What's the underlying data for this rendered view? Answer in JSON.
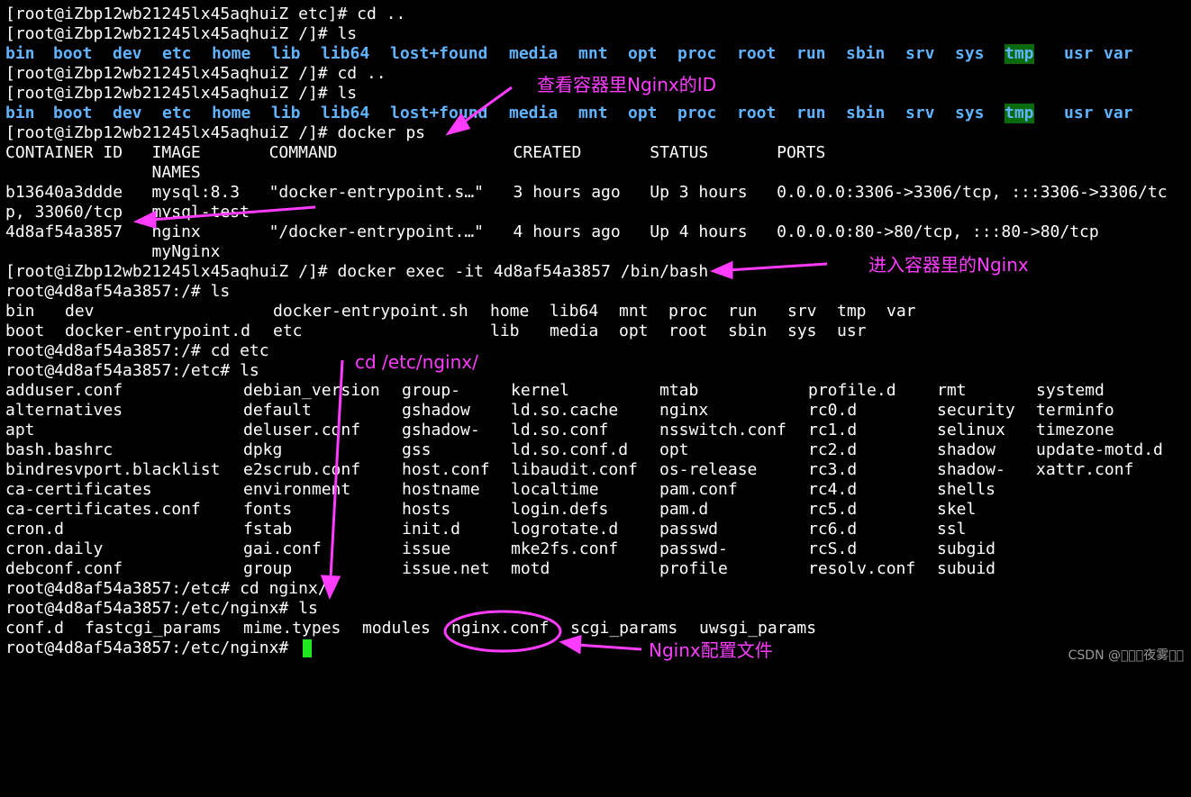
{
  "theme": {
    "background": "#000000",
    "text": "#ffffff",
    "directory": "#5fb3ff",
    "tmp_highlight": "#0a6b0a",
    "annotation": "#ff3cff",
    "cursor": "#1fe81f"
  },
  "terminal": {
    "l1": "[root@iZbp12wb21245lx45aqhuiZ etc]# cd ..",
    "l2": "[root@iZbp12wb21245lx45aqhuiZ /]# ls",
    "ls1": [
      "bin",
      "boot",
      "dev",
      "etc",
      "home",
      "lib",
      "lib64",
      "lost+found",
      "media",
      "mnt",
      "opt",
      "proc",
      "root",
      "run",
      "sbin",
      "srv",
      "sys",
      "tmp",
      "usr",
      "var"
    ],
    "l4": "[root@iZbp12wb21245lx45aqhuiZ /]# cd ..",
    "l5": "[root@iZbp12wb21245lx45aqhuiZ /]# ls",
    "ls2": [
      "bin",
      "boot",
      "dev",
      "etc",
      "home",
      "lib",
      "lib64",
      "lost+found",
      "media",
      "mnt",
      "opt",
      "proc",
      "root",
      "run",
      "sbin",
      "srv",
      "sys",
      "tmp",
      "usr",
      "var"
    ],
    "l7": "[root@iZbp12wb21245lx45aqhuiZ /]# docker ps",
    "ps_header": "CONTAINER ID   IMAGE       COMMAND                  CREATED       STATUS       PORTS",
    "ps_header2": "               NAMES",
    "ps_row1": "b13640a3ddde   mysql:8.3   \"docker-entrypoint.s…\"   3 hours ago   Up 3 hours   0.0.0.0:3306->3306/tcp, :::3306->3306/tc",
    "ps_row1b": "p, 33060/tcp   mysql-test",
    "ps_row2": "4d8af54a3857   nginx       \"/docker-entrypoint.…\"   4 hours ago   Up 4 hours   0.0.0.0:80->80/tcp, :::80->80/tcp",
    "ps_row2b": "               myNginx",
    "l14": "[root@iZbp12wb21245lx45aqhuiZ /]# docker exec -it 4d8af54a3857 /bin/bash",
    "l15": "root@4d8af54a3857:/# ls",
    "root_ls": [
      [
        "bin",
        "dev",
        "docker-entrypoint.sh",
        "home",
        "lib64",
        "mnt",
        "proc",
        "run",
        "srv",
        "tmp",
        "var"
      ],
      [
        "boot",
        "docker-entrypoint.d",
        "etc",
        "lib",
        "media",
        "opt",
        "root",
        "sbin",
        "sys",
        "usr"
      ]
    ],
    "l18": "root@4d8af54a3857:/# cd etc",
    "l19": "root@4d8af54a3857:/etc# ls",
    "etc_ls": [
      [
        "adduser.conf",
        "debian_version",
        "group-",
        "kernel",
        "mtab",
        "profile.d",
        "rmt",
        "systemd"
      ],
      [
        "alternatives",
        "default",
        "gshadow",
        "ld.so.cache",
        "nginx",
        "rc0.d",
        "security",
        "terminfo"
      ],
      [
        "apt",
        "deluser.conf",
        "gshadow-",
        "ld.so.conf",
        "nsswitch.conf",
        "rc1.d",
        "selinux",
        "timezone"
      ],
      [
        "bash.bashrc",
        "dpkg",
        "gss",
        "ld.so.conf.d",
        "opt",
        "rc2.d",
        "shadow",
        "update-motd.d"
      ],
      [
        "bindresvport.blacklist",
        "e2scrub.conf",
        "host.conf",
        "libaudit.conf",
        "os-release",
        "rc3.d",
        "shadow-",
        "xattr.conf"
      ],
      [
        "ca-certificates",
        "environment",
        "hostname",
        "localtime",
        "pam.conf",
        "rc4.d",
        "shells",
        ""
      ],
      [
        "ca-certificates.conf",
        "fonts",
        "hosts",
        "login.defs",
        "pam.d",
        "rc5.d",
        "skel",
        ""
      ],
      [
        "cron.d",
        "fstab",
        "init.d",
        "logrotate.d",
        "passwd",
        "rc6.d",
        "ssl",
        ""
      ],
      [
        "cron.daily",
        "gai.conf",
        "issue",
        "mke2fs.conf",
        "passwd-",
        "rcS.d",
        "subgid",
        ""
      ],
      [
        "debconf.conf",
        "group",
        "issue.net",
        "motd",
        "profile",
        "resolv.conf",
        "subuid",
        ""
      ]
    ],
    "l30": "root@4d8af54a3857:/etc# cd nginx/",
    "l31": "root@4d8af54a3857:/etc/nginx# ls",
    "nginx_ls": [
      "conf.d",
      "fastcgi_params",
      "mime.types",
      "modules",
      "nginx.conf",
      "scgi_params",
      "uwsgi_params"
    ],
    "l33": "root@4d8af54a3857:/etc/nginx# "
  },
  "annotations": {
    "a1": "查看容器里Nginx的ID",
    "a2": "进入容器里的Nginx",
    "a3": "cd /etc/nginx/",
    "a4": "Nginx配置文件"
  },
  "watermark": "CSDN @\u0000\u0000\u0000夜雾\u0000\u0000"
}
